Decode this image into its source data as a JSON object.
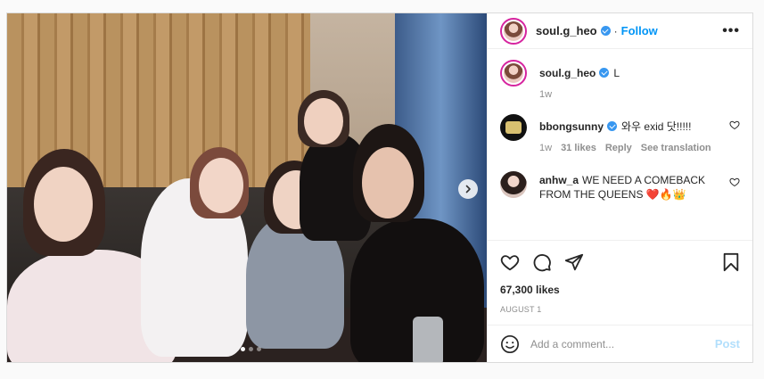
{
  "post": {
    "author": "soul.g_heo",
    "follow_label": "Follow",
    "more_label": "•••",
    "caption_user": "soul.g_heo",
    "caption_text": "L",
    "caption_time": "1w",
    "carousel": {
      "slide_count": 3,
      "active_index": 1
    }
  },
  "comments": [
    {
      "user": "bbongsunny",
      "verified": true,
      "text": "와우 exid 닷!!!!!",
      "time": "1w",
      "likes": "31 likes",
      "reply_label": "Reply",
      "translation_label": "See translation"
    },
    {
      "user": "anhw_a",
      "verified": false,
      "text": "WE NEED A COMEBACK FROM THE QUEENS ❤️🔥👑"
    }
  ],
  "actions": {
    "likes": "67,300 likes",
    "date": "AUGUST 1",
    "comment_placeholder": "Add a comment...",
    "post_label": "Post"
  },
  "colors": {
    "accent": "#0095f6",
    "verified": "#3897f0",
    "post_disabled": "#b2dffc",
    "muted": "#8e8e8e"
  },
  "icons": [
    "heart-icon",
    "comment-icon",
    "share-icon",
    "bookmark-icon",
    "emoji-icon",
    "verified-icon",
    "chevron-right-icon"
  ]
}
